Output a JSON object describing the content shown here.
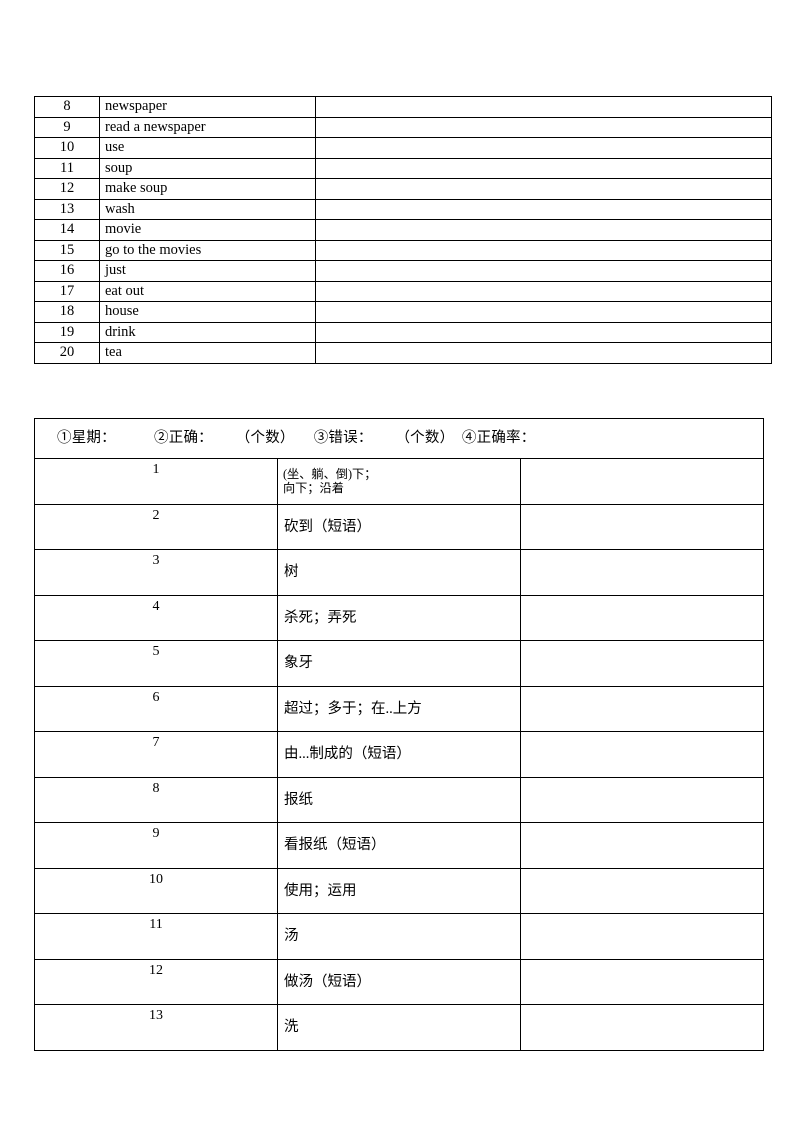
{
  "document": {
    "vocab_table": {
      "columns": [
        "number",
        "term",
        "answer"
      ],
      "rows": [
        {
          "number": "8",
          "term": "newspaper",
          "answer": ""
        },
        {
          "number": "9",
          "term": "read a newspaper",
          "answer": ""
        },
        {
          "number": "10",
          "term": "use",
          "answer": ""
        },
        {
          "number": "11",
          "term": "soup",
          "answer": ""
        },
        {
          "number": "12",
          "term": "make soup",
          "answer": ""
        },
        {
          "number": "13",
          "term": "wash",
          "answer": ""
        },
        {
          "number": "14",
          "term": "movie",
          "answer": ""
        },
        {
          "number": "15",
          "term": "go to the movies",
          "answer": ""
        },
        {
          "number": "16",
          "term": "just",
          "answer": ""
        },
        {
          "number": "17",
          "term": "eat out",
          "answer": ""
        },
        {
          "number": "18",
          "term": "house",
          "answer": ""
        },
        {
          "number": "19",
          "term": "drink",
          "answer": ""
        },
        {
          "number": "20",
          "term": "tea",
          "answer": ""
        }
      ]
    },
    "meaning_table": {
      "header": "①星期：          ②正确：      （个数）     ③错误：      （个数）  ④正确率：",
      "header_parts": [
        {
          "label": "①星期："
        },
        {
          "label": "②正确："
        },
        {
          "label": "（个数）"
        },
        {
          "label": "③错误："
        },
        {
          "label": "（个数）"
        },
        {
          "label": "④正确率："
        }
      ],
      "columns": [
        "number",
        "meaning",
        "answer"
      ],
      "rows": [
        {
          "number": "1",
          "meaning_line1": "(坐、躺、倒)下；",
          "meaning_line2": "向下；沿着",
          "answer": ""
        },
        {
          "number": "2",
          "meaning": "砍到（短语）",
          "answer": ""
        },
        {
          "number": "3",
          "meaning": "树",
          "answer": ""
        },
        {
          "number": "4",
          "meaning": "杀死；弄死",
          "answer": ""
        },
        {
          "number": "5",
          "meaning": "象牙",
          "answer": ""
        },
        {
          "number": "6",
          "meaning": "超过；多于；在..上方",
          "answer": ""
        },
        {
          "number": "7",
          "meaning": "由...制成的（短语）",
          "answer": ""
        },
        {
          "number": "8",
          "meaning": "报纸",
          "answer": ""
        },
        {
          "number": "9",
          "meaning": "看报纸（短语）",
          "answer": ""
        },
        {
          "number": "10",
          "meaning": "使用；运用",
          "answer": ""
        },
        {
          "number": "11",
          "meaning": "汤",
          "answer": ""
        },
        {
          "number": "12",
          "meaning": "做汤（短语）",
          "answer": ""
        },
        {
          "number": "13",
          "meaning": "洗",
          "answer": ""
        }
      ]
    }
  }
}
